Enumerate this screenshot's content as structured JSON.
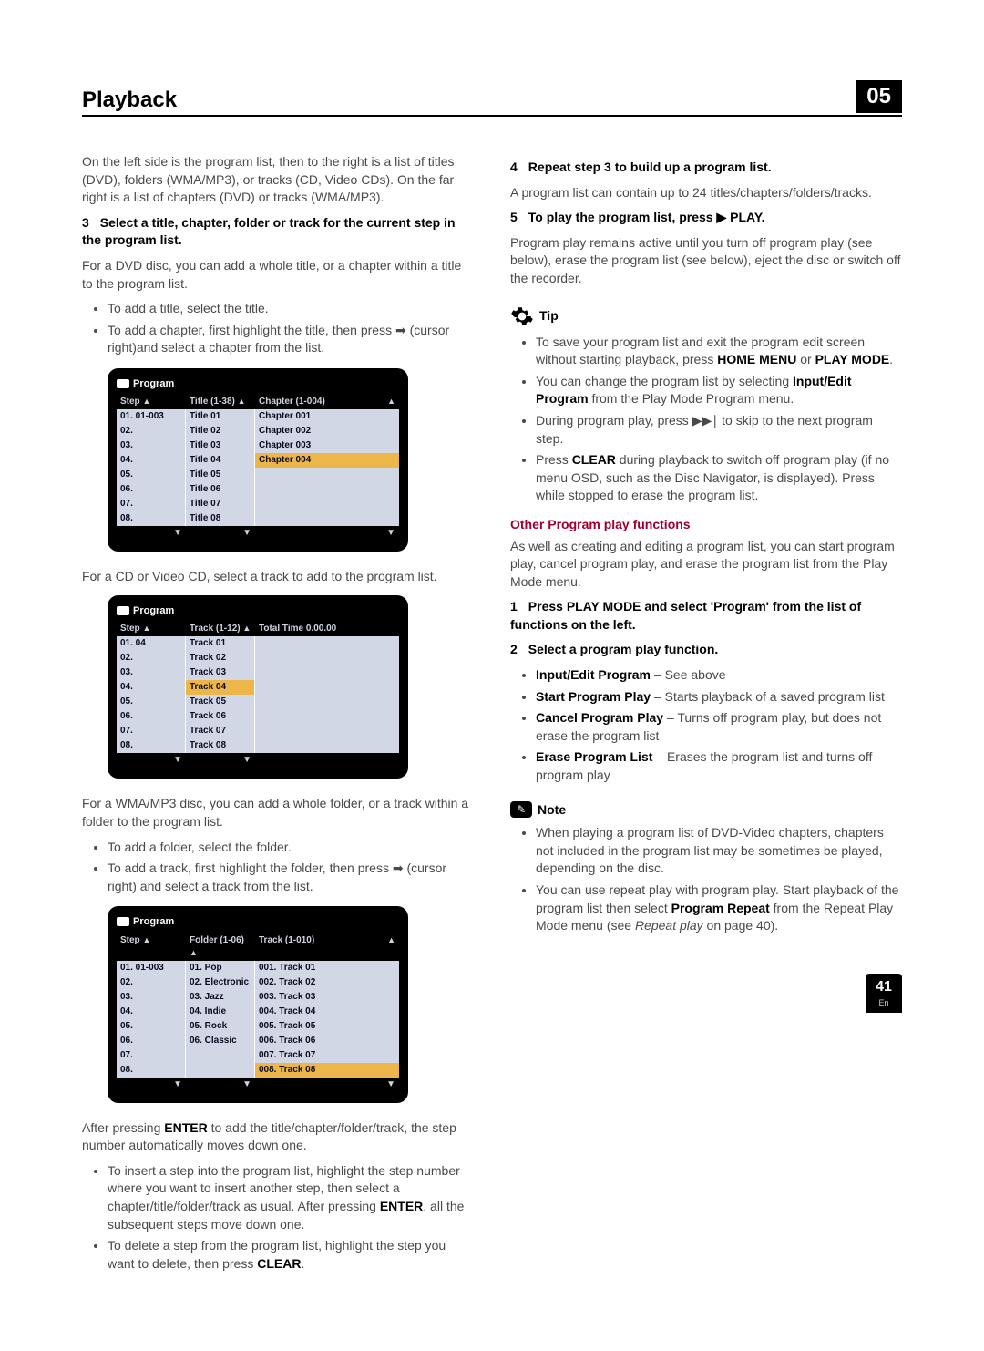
{
  "header": {
    "title": "Playback",
    "chapter": "05"
  },
  "left": {
    "intro": "On the left side is the program list, then to the right is a list of titles (DVD), folders (WMA/MP3), or tracks (CD, Video CDs). On the far right is a list of chapters (DVD) or tracks (WMA/MP3).",
    "step3_head": "Select a title, chapter, folder or track for the current step in the program list.",
    "step3_body": "For a DVD disc, you can add a whole title, or a chapter within a title to the program list.",
    "bul1": "To add a title, select the title.",
    "bul2_a": "To add a chapter, first highlight the title, then press ",
    "bul2_b": " (cursor right)and select a chapter from the list.",
    "fig1_label": "Program",
    "fig1": {
      "h1": "Step",
      "h2": "Title (1-38)",
      "h3": "Chapter (1-004)",
      "steps": [
        "01. 01-003",
        "02.",
        "03.",
        "04.",
        "05.",
        "06.",
        "07.",
        "08."
      ],
      "titles": [
        "Title 01",
        "Title 02",
        "Title 03",
        "Title 04",
        "Title 05",
        "Title 06",
        "Title 07",
        "Title 08"
      ],
      "chapters": [
        "Chapter 001",
        "Chapter 002",
        "Chapter 003",
        "Chapter 004",
        "",
        "",
        "",
        ""
      ]
    },
    "after_fig1": "For a CD or Video CD, select a track to add to the program list.",
    "fig2": {
      "h1": "Step",
      "h2": "Track (1-12)",
      "h3": "Total Time 0.00.00",
      "steps": [
        "01. 04",
        "02.",
        "03.",
        "04.",
        "05.",
        "06.",
        "07.",
        "08."
      ],
      "tracks": [
        "Track 01",
        "Track 02",
        "Track 03",
        "Track 04",
        "Track 05",
        "Track 06",
        "Track 07",
        "Track 08"
      ]
    },
    "after_fig2": "For a WMA/MP3 disc, you can add a whole folder, or a track within a folder to the program list.",
    "bul3": "To add a folder, select the folder.",
    "bul4_a": "To add a track, first highlight the folder, then press ",
    "bul4_b": " (cursor right) and select a track from the list.",
    "fig3": {
      "h1": "Step",
      "h2": "Folder (1-06)",
      "h3": "Track (1-010)",
      "steps": [
        "01. 01-003",
        "02.",
        "03.",
        "04.",
        "05.",
        "06.",
        "07.",
        "08."
      ],
      "folders": [
        "01. Pop",
        "02. Electronic",
        "03. Jazz",
        "04. Indie",
        "05. Rock",
        "06. Classic",
        "",
        ""
      ],
      "tracks": [
        "001. Track 01",
        "002. Track 02",
        "003. Track 03",
        "004. Track 04",
        "005. Track 05",
        "006. Track 06",
        "007. Track 07",
        "008. Track 08"
      ]
    },
    "after_fig3_a": "After pressing ",
    "after_fig3_b": " to add the title/chapter/folder/track, the step number automatically moves down one.",
    "enter": "ENTER",
    "bul5_a": "To insert a step into the program list, highlight the step number where you want to insert another step, then select a chapter/title/folder/track as usual. After pressing ",
    "bul5_b": ", all the subsequent steps move down one.",
    "bul6_a": "To delete a step from the program list, highlight the step you want to delete, then press ",
    "bul6_b": ".",
    "clear": "CLEAR"
  },
  "right": {
    "step4_head": "Repeat step 3 to build up a program list.",
    "step4_body": "A program list can contain up to 24 titles/chapters/folders/tracks.",
    "step5_head_a": "To play the program list, press ",
    "step5_head_b": " PLAY.",
    "step5_body": "Program play remains active until you turn off program play (see below), erase the program list (see below), eject the disc or switch off the recorder.",
    "tip_label": "Tip",
    "tip1_a": "To save your program list and exit the program edit screen without starting playback, press ",
    "tip1_b": " or ",
    "home_menu": "HOME MENU",
    "play_mode": "PLAY MODE",
    "tip1_c": ".",
    "tip2_a": "You can change the program list by selecting ",
    "tip2_b": " from the Play Mode Program menu.",
    "input_edit": "Input/Edit Program",
    "tip3_a": "During program play, press ",
    "tip3_b": " to skip to the next program step.",
    "tip4_a": "Press ",
    "tip4_b": " during playback to switch off program play (if no menu OSD, such as the Disc Navigator, is displayed). Press while stopped to erase the program list.",
    "clear": "CLEAR",
    "sub_head": "Other Program play functions",
    "sub_body": "As well as creating and editing a program list, you can start program play, cancel program play, and erase the program list from the Play Mode menu.",
    "r1_head": "Press PLAY MODE and select 'Program' from the list of functions on the left.",
    "r2_head": "Select a program play function.",
    "r2_b1_name": "Input/Edit Program",
    "r2_b1_desc": " – See above",
    "r2_b2_name": "Start Program Play",
    "r2_b2_desc": " – Starts playback of a saved program list",
    "r2_b3_name": "Cancel Program Play",
    "r2_b3_desc": " – Turns off program play, but does not erase the program list",
    "r2_b4_name": "Erase Program List",
    "r2_b4_desc": " – Erases the program list and turns off program play",
    "note_label": "Note",
    "note1": "When playing a program list of DVD-Video chapters, chapters not included in the program list may be sometimes be played, depending on the disc.",
    "note2_a": "You can use repeat play with program play. Start playback of the program list then select ",
    "note2_b": " from the Repeat Play Mode menu (see ",
    "pr": "Program Repeat",
    "note2_c": " on page 40).",
    "rp_it": "Repeat play"
  },
  "footer": {
    "page": "41",
    "lang": "En"
  }
}
